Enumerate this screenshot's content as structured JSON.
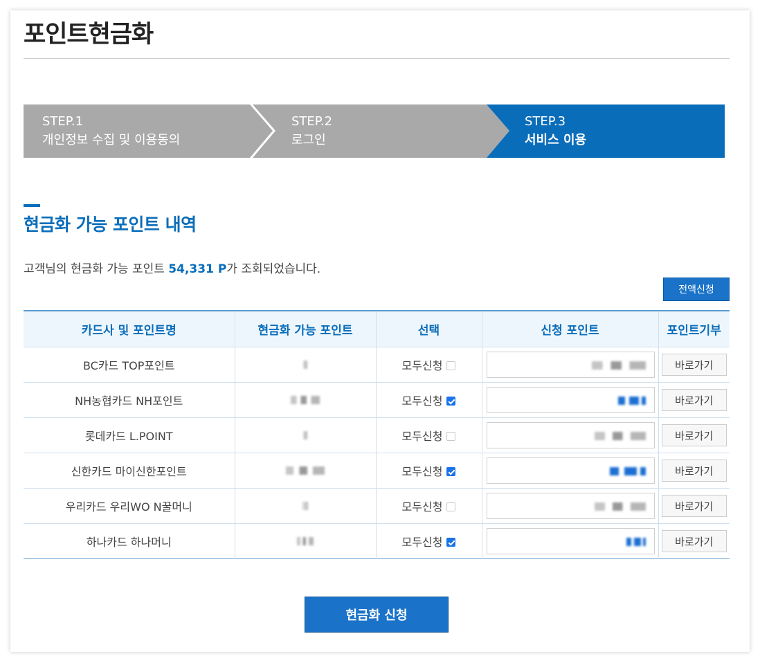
{
  "page": {
    "title": "포인트현금화"
  },
  "steps": [
    {
      "num": "STEP.1",
      "label": "개인정보 수집 및 이용동의"
    },
    {
      "num": "STEP.2",
      "label": "로그인"
    },
    {
      "num": "STEP.3",
      "label": "서비스 이용"
    }
  ],
  "section": {
    "title": "현금화 가능 포인트 내역",
    "summary_prefix": "고객님의 현금화 가능 포인트 ",
    "summary_points": "54,331 P",
    "summary_suffix": "가 조회되었습니다.",
    "all_apply_label": "전액신청"
  },
  "table": {
    "headers": [
      "카드사 및 포인트명",
      "현금화 가능 포인트",
      "선택",
      "신청 포인트",
      "포인트기부"
    ],
    "select_label": "모두신청",
    "goto_label": "바로가기",
    "rows": [
      {
        "name": "BC카드 TOP포인트",
        "checked": false
      },
      {
        "name": "NH농협카드 NH포인트",
        "checked": true
      },
      {
        "name": "롯데카드 L.POINT",
        "checked": false
      },
      {
        "name": "신한카드 마이신한포인트",
        "checked": true
      },
      {
        "name": "우리카드 우리WO N꿀머니",
        "checked": false
      },
      {
        "name": "하나카드 하나머니",
        "checked": true
      }
    ]
  },
  "footer": {
    "submit_label": "현금화 신청"
  },
  "colors": {
    "accent": "#0a6dba",
    "step_inactive": "#a9a9a9",
    "header_bg": "#eef6fd"
  }
}
